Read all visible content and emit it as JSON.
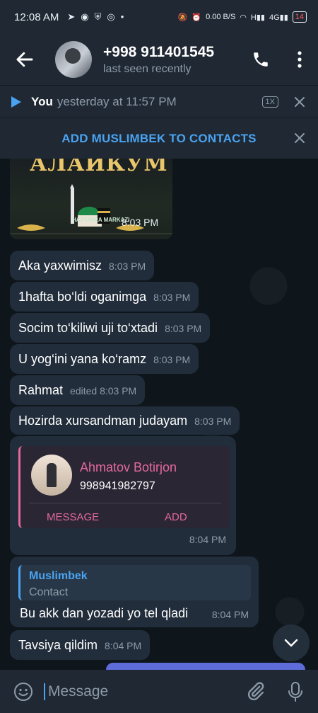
{
  "status_bar": {
    "time": "12:08 AM",
    "left_icons": [
      "telegram-icon",
      "messenger-icon",
      "shield-icon",
      "instagram-icon",
      "dot"
    ],
    "net_speed": "0.00 B/S",
    "battery": "14"
  },
  "header": {
    "title": "+998 911401545",
    "subtitle": "last seen recently"
  },
  "audio_bar": {
    "author": "You",
    "time": "yesterday at 11:57 PM",
    "speed": "1X"
  },
  "add_contact_bar": {
    "label": "ADD MUSLIMBEK TO CONTACTS"
  },
  "image_message": {
    "title_text": "АЛАЙКУМ",
    "brand": "HAJ-UMRA MARKAZI",
    "time": "8:03 PM"
  },
  "messages": [
    {
      "text": "Aka yaxwimisz",
      "time": "8:03 PM"
    },
    {
      "text": "1hafta bo‘ldi oganimga",
      "time": "8:03 PM"
    },
    {
      "text": "Socim to‘kiliwi uji to‘xtadi",
      "time": "8:03 PM"
    },
    {
      "text": "U yog‘ini yana ko‘ramz",
      "time": "8:03 PM"
    },
    {
      "text": "Rahmat",
      "time": "edited 8:03 PM"
    },
    {
      "text": "Hozirda xursandman judayam",
      "time": "8:03 PM"
    }
  ],
  "contact_card": {
    "name": "Ahmatov Botirjon",
    "phone": "998941982797",
    "message_label": "MESSAGE",
    "add_label": "ADD",
    "time": "8:04 PM"
  },
  "reply_message": {
    "quote_name": "Muslimbek",
    "quote_sub": "Contact",
    "text": "Bu akk dan yozadi yo tel qladi",
    "time": "8:04 PM"
  },
  "last_message": {
    "text": "Tavsiya qildim",
    "time": "8:04 PM"
  },
  "input": {
    "placeholder": "Message"
  },
  "colors": {
    "accent": "#4aa3f0",
    "contact_accent": "#e46a9c",
    "bubble": "#212d3b",
    "bar": "#1f2833"
  }
}
